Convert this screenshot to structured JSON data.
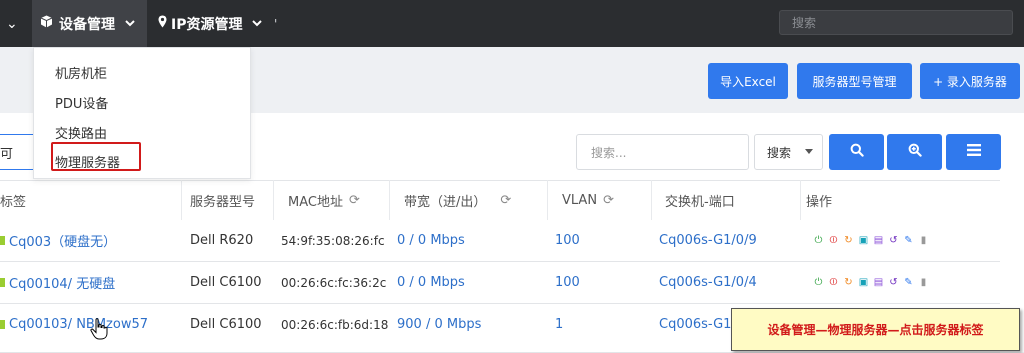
{
  "navbar": {
    "device_mgmt_label": "设备管理",
    "ip_mgmt_label": "IP资源管理",
    "tick": "'",
    "search_placeholder": "搜索"
  },
  "dropdown": {
    "items": [
      "机房机柜",
      "PDU设备",
      "交换路由",
      "物理服务器"
    ]
  },
  "actions": {
    "import_label": "导入Excel",
    "model_label": "服务器型号管理",
    "add_label": "+ 录入服务器"
  },
  "filters": {
    "left_value": "可",
    "search_placeholder": "搜索...",
    "search_select": "搜索"
  },
  "table": {
    "headers": [
      "标签",
      "服务器型号",
      "MAC地址",
      "带宽（进/出）",
      "VLAN",
      "交换机-端口",
      "操作"
    ],
    "rows": [
      {
        "tag": "Cq003（硬盘无）",
        "model": "Dell R620",
        "mac": "54:9f:35:08:26:fc",
        "bandwidth": "0 / 0 Mbps",
        "vlan": "100",
        "switch": "Cq006s-G1/0/9"
      },
      {
        "tag": "Cq00104/ 无硬盘",
        "model": "Dell C6100",
        "mac": "00:26:6c:fc:36:2c",
        "bandwidth": "0 / 0 Mbps",
        "vlan": "100",
        "switch": "Cq006s-G1/0/4"
      },
      {
        "tag": "Cq00103/ NBMzow57",
        "model": "Dell C6100",
        "mac": "00:26:6c:fb:6d:18",
        "bandwidth": "900 / 0 Mbps",
        "vlan": "1",
        "switch": "Cq006s-G1/"
      }
    ]
  },
  "callout": {
    "text": "设备管理—物理服务器—点击服务器标签"
  },
  "colors": {
    "accent": "#3079ed",
    "highlight": "#d11a1a",
    "navbar": "#2b2d30"
  }
}
